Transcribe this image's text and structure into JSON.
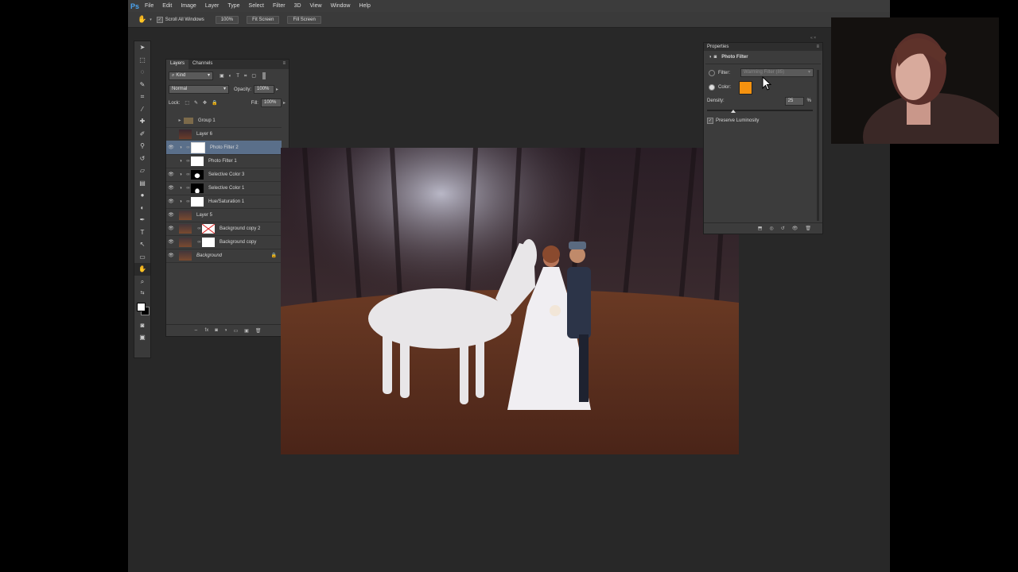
{
  "menu": {
    "logo": "Ps",
    "items": [
      "File",
      "Edit",
      "Image",
      "Layer",
      "Type",
      "Select",
      "Filter",
      "3D",
      "View",
      "Window",
      "Help"
    ]
  },
  "options": {
    "scroll_all": "Scroll All Windows",
    "zoom_100": "100%",
    "fit_screen": "Fit Screen",
    "fill_screen": "Fill Screen"
  },
  "layers_panel": {
    "tabs": [
      "Layers",
      "Channels"
    ],
    "filter_kind": "Kind",
    "blend_mode": "Normal",
    "opacity_label": "Opacity:",
    "opacity_value": "100%",
    "lock_label": "Lock:",
    "fill_label": "Fill:",
    "fill_value": "100%",
    "layers": [
      {
        "name": "Group 1",
        "type": "group",
        "visible": false
      },
      {
        "name": "Layer 6",
        "type": "pixel",
        "visible": false
      },
      {
        "name": "Photo Filter 2",
        "type": "adjustment",
        "visible": true,
        "selected": true
      },
      {
        "name": "Photo Filter 1",
        "type": "adjustment",
        "visible": false
      },
      {
        "name": "Selective Color 3",
        "type": "adjustment",
        "visible": true
      },
      {
        "name": "Selective Color 1",
        "type": "adjustment",
        "visible": true
      },
      {
        "name": "Hue/Saturation 1",
        "type": "adjustment",
        "visible": true
      },
      {
        "name": "Layer 5",
        "type": "pixel",
        "visible": true
      },
      {
        "name": "Background copy 2",
        "type": "pixel",
        "visible": true
      },
      {
        "name": "Background copy",
        "type": "pixel",
        "visible": true
      },
      {
        "name": "Background",
        "type": "background",
        "visible": true
      }
    ]
  },
  "properties_panel": {
    "title": "Properties",
    "adjustment_name": "Photo Filter",
    "filter_label": "Filter:",
    "filter_value": "Warming Filter (85)",
    "color_label": "Color:",
    "color_value": "#f5920f",
    "density_label": "Density:",
    "density_value": "25",
    "density_unit": "%",
    "density_level": 0.25,
    "preserve_luminosity": "Preserve Luminosity"
  },
  "colors": {
    "accent_selected_row": "#5a6f8a",
    "filter_color": "#f5920f"
  }
}
